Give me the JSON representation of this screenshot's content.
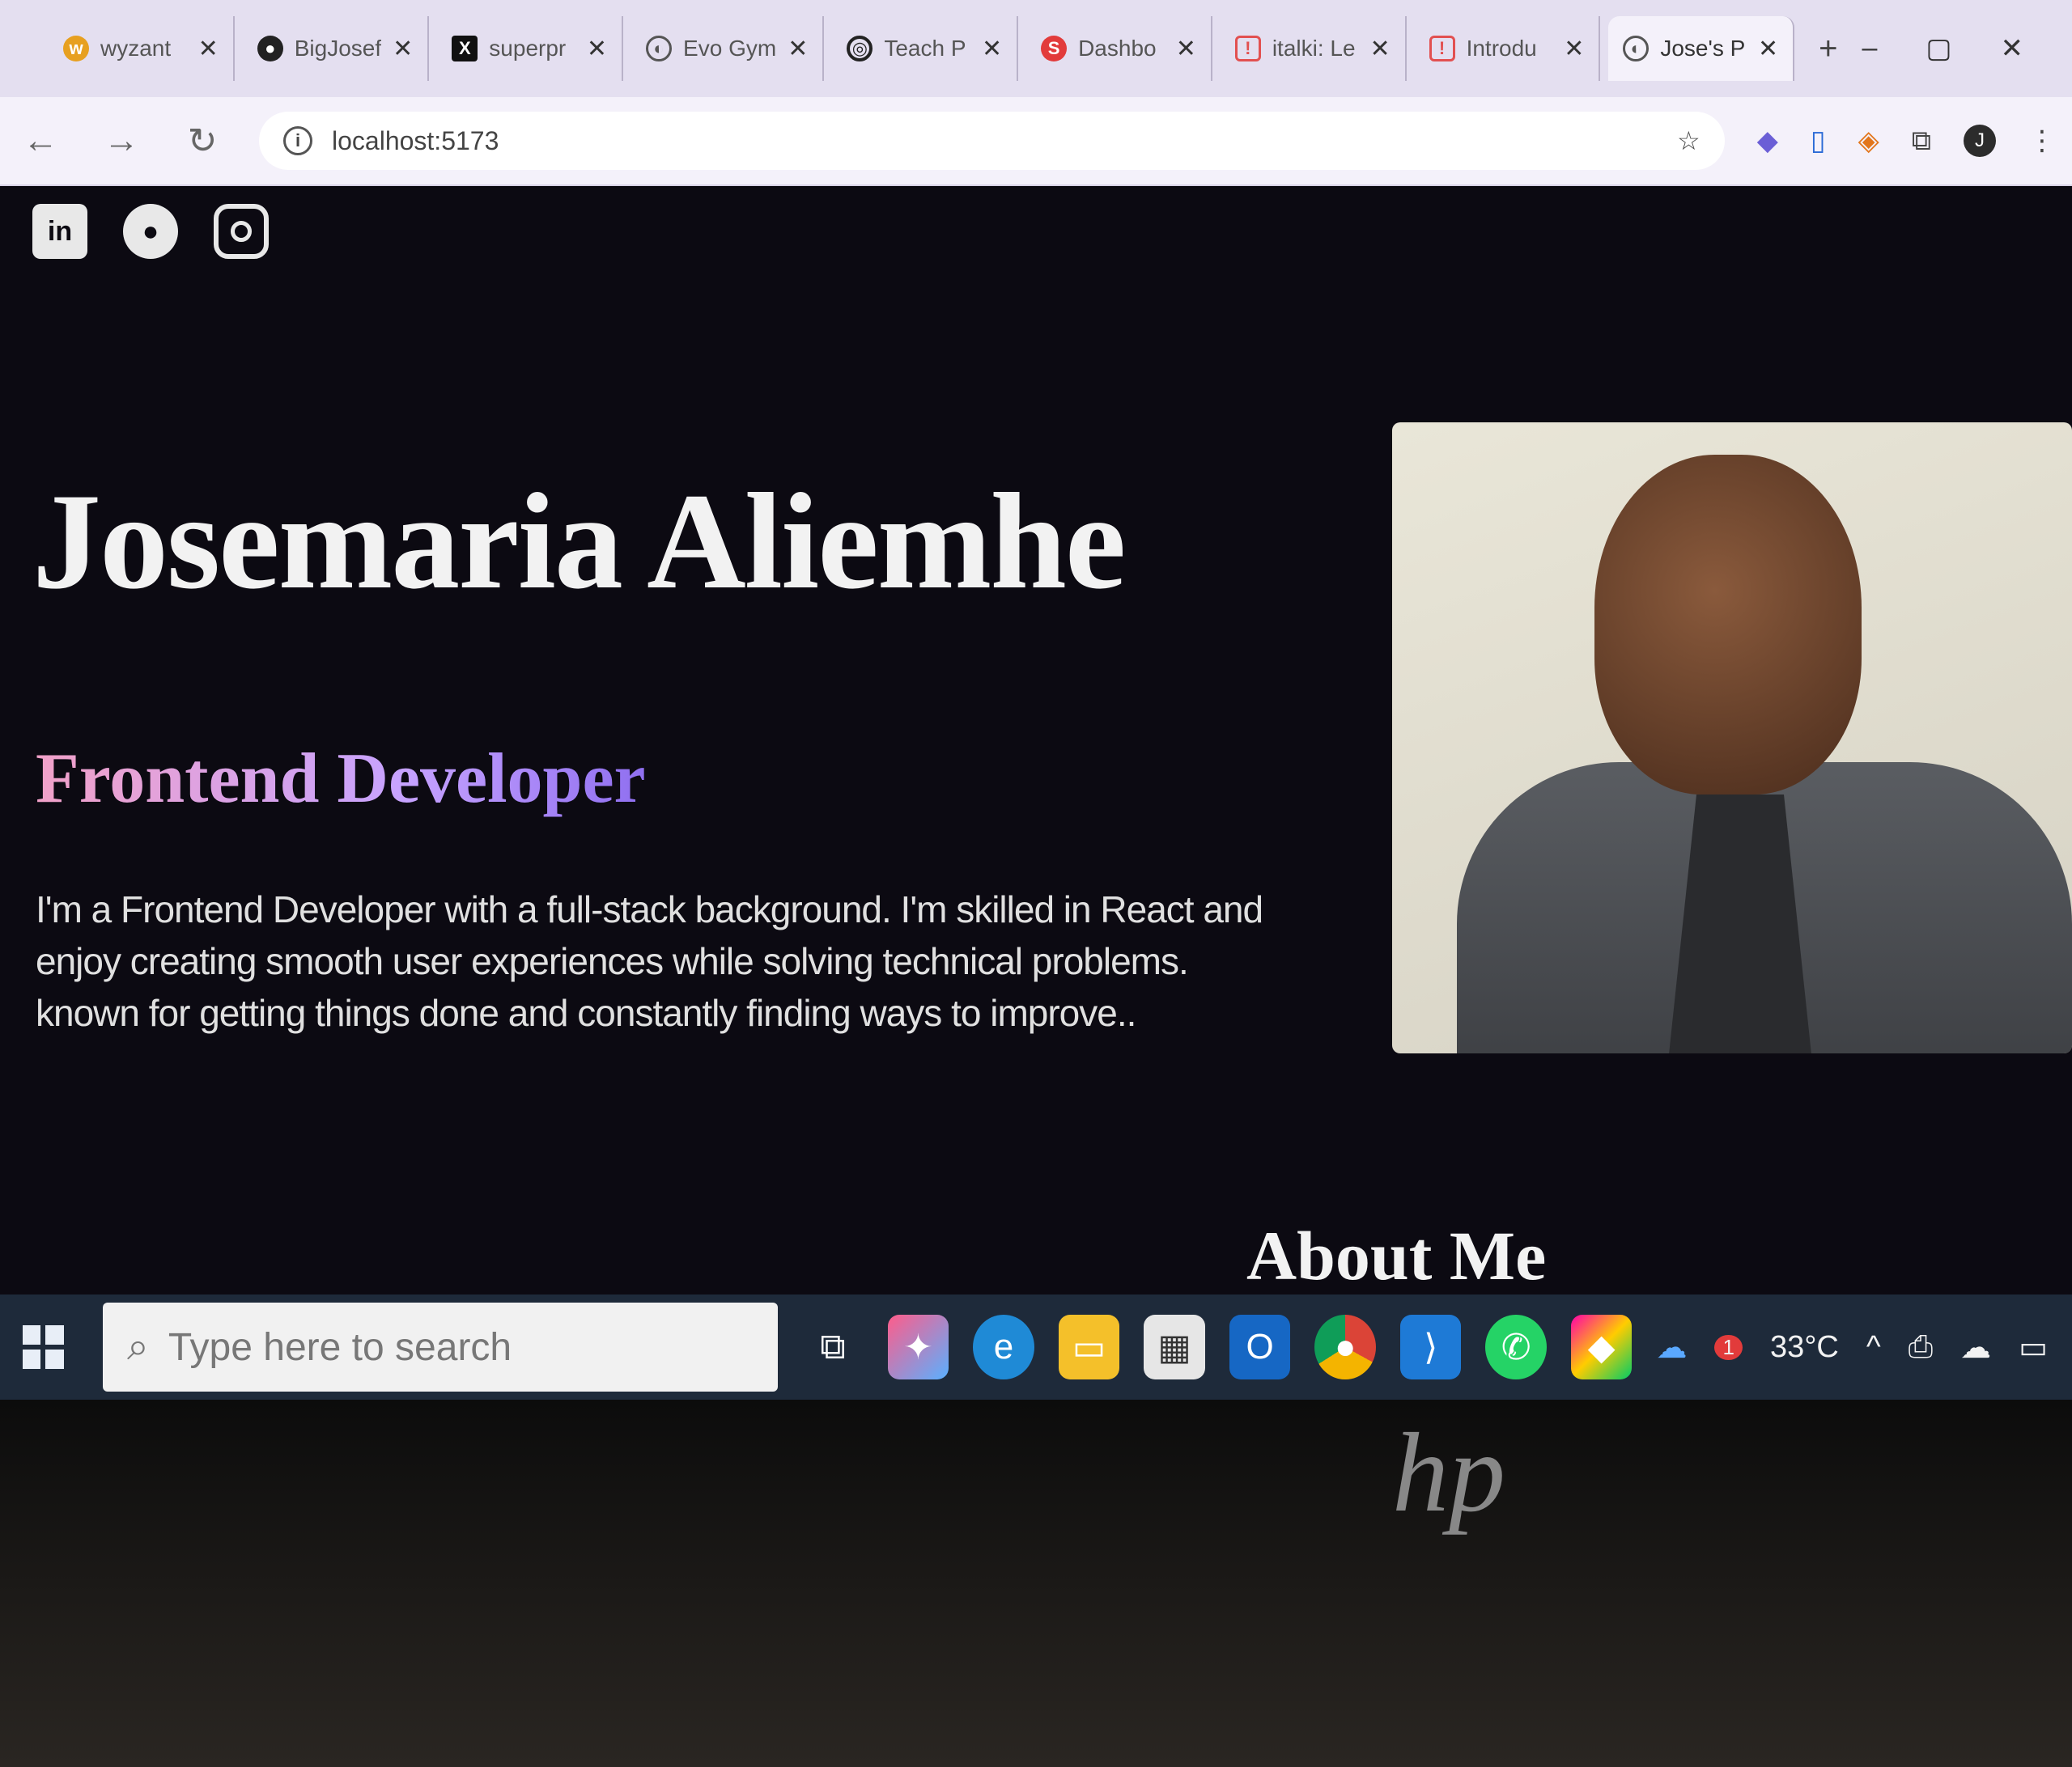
{
  "browser": {
    "tabs": [
      {
        "title": "wyzant",
        "icon": "wyzant-icon"
      },
      {
        "title": "BigJosef",
        "icon": "github-icon"
      },
      {
        "title": "superpr",
        "icon": "x-icon"
      },
      {
        "title": "Evo Gym",
        "icon": "globe-icon"
      },
      {
        "title": "Teach P",
        "icon": "target-icon"
      },
      {
        "title": "Dashbo",
        "icon": "red-circle-icon"
      },
      {
        "title": "italki: Le",
        "icon": "italki-icon"
      },
      {
        "title": "Introdu",
        "icon": "italki-icon"
      },
      {
        "title": "Jose's P",
        "icon": "globe-icon",
        "active": true
      }
    ],
    "new_tab": "+",
    "window_controls": {
      "minimize": "–",
      "maximize": "▢",
      "close": "✕"
    },
    "address": "localhost:5173",
    "profile_initial": "J"
  },
  "page": {
    "socials": [
      "linkedin-icon",
      "github-icon",
      "instagram-icon"
    ],
    "linkedin_label": "in",
    "name": "Josemaria Aliemhe",
    "role": "Frontend Developer",
    "bio": "I'm a Frontend Developer with a full-stack background. I'm skilled in React and enjoy creating smooth user experiences while solving technical problems. known for getting things done and constantly finding ways to improve..",
    "about_heading": "About Me"
  },
  "taskbar": {
    "search_placeholder": "Type here to search",
    "apps": [
      "task-view-icon",
      "copilot-icon",
      "edge-icon",
      "file-explorer-icon",
      "store-icon",
      "outlook-icon",
      "chrome-icon",
      "vscode-icon",
      "whatsapp-icon",
      "app-icon"
    ],
    "weather": "33°C",
    "weather_badge": "1"
  },
  "colors": {
    "page_bg": "#0c0a12",
    "role_gradient_start": "#f1a1c8",
    "role_gradient_end": "#8f6ff0"
  }
}
